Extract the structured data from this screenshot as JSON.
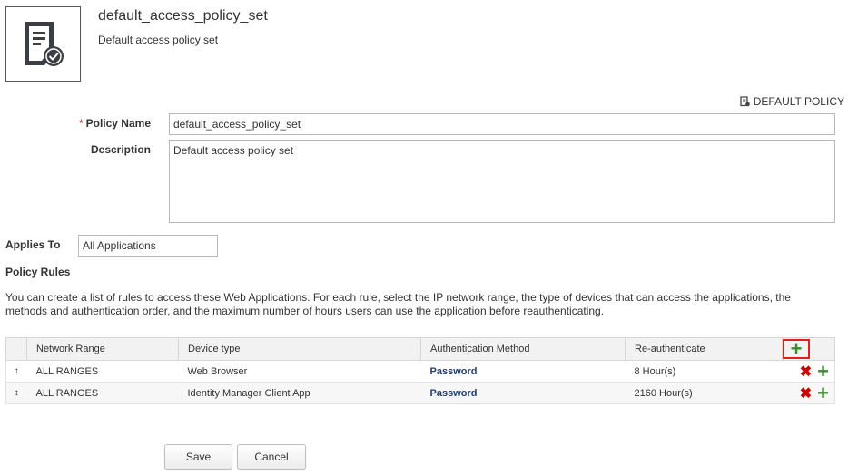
{
  "header": {
    "title": "default_access_policy_set",
    "subtitle": "Default access policy set",
    "icon": "policy-document-check-icon"
  },
  "default_policy": {
    "label": "DEFAULT POLICY",
    "icon": "policy-small-icon"
  },
  "form": {
    "policy_name": {
      "required_mark": "*",
      "label": "Policy Name",
      "value": "default_access_policy_set"
    },
    "description": {
      "label": "Description",
      "value": "Default access policy set"
    },
    "applies_to": {
      "label": "Applies To",
      "value": "All Applications"
    }
  },
  "rules": {
    "title": "Policy Rules",
    "help_text": "You can create a list of rules to access these Web Applications. For each rule, select the IP network range, the type of devices that can access the applications, the methods and authentication order, and the maximum number of hours users can use the application before reauthenticating.",
    "columns": [
      "Network Range",
      "Device type",
      "Authentication Method",
      "Re-authenticate"
    ],
    "rows": [
      {
        "network_range": "ALL RANGES",
        "device_type": "Web Browser",
        "auth_method": "Password",
        "reauth": "8 Hour(s)"
      },
      {
        "network_range": "ALL RANGES",
        "device_type": "Identity Manager Client App",
        "auth_method": "Password",
        "reauth": "2160 Hour(s)"
      }
    ]
  },
  "buttons": {
    "save": "Save",
    "cancel": "Cancel"
  },
  "colors": {
    "accent_link": "#1f3f73",
    "add_green": "#3c8c2f",
    "delete_red": "#cc0000",
    "highlight_red": "#e21f1f"
  }
}
